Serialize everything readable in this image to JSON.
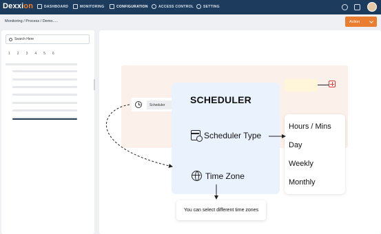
{
  "app": {
    "logo_main": "Dexxi",
    "logo_accent": "on",
    "brand_color": "#1d3b5c",
    "accent_color": "#e97e31"
  },
  "nav": {
    "items": [
      {
        "label": "DASHBOARD",
        "icon": "dashboard-icon"
      },
      {
        "label": "MONITORING",
        "icon": "monitor-icon"
      },
      {
        "label": "CONFIGURATION",
        "icon": "list-icon",
        "active": true
      },
      {
        "label": "ACCESS CONTROL",
        "icon": "clock-icon"
      },
      {
        "label": "SETTING",
        "icon": "gear-icon"
      }
    ],
    "right_icons": [
      "plus-circle-icon",
      "hub-icon",
      "grid-icon",
      "avatar"
    ]
  },
  "subheader": {
    "breadcrumb": "Monitoring /  Process / Demo.....",
    "action_label": "Action"
  },
  "left_panel": {
    "search_placeholder": "Search Here",
    "pages": [
      "1",
      "2",
      "3",
      "4",
      "5",
      "6"
    ]
  },
  "flow": {
    "scheduler_node_label": "Scheduler"
  },
  "scheduler_card": {
    "title": "SCHEDULER",
    "type_label": "Scheduler Type",
    "timezone_label": "Time Zone"
  },
  "scheduler_type_options": [
    "Hours / Mins",
    "Day",
    "Weekly",
    "Monthly"
  ],
  "timezone_hint": "You can select different time zones"
}
